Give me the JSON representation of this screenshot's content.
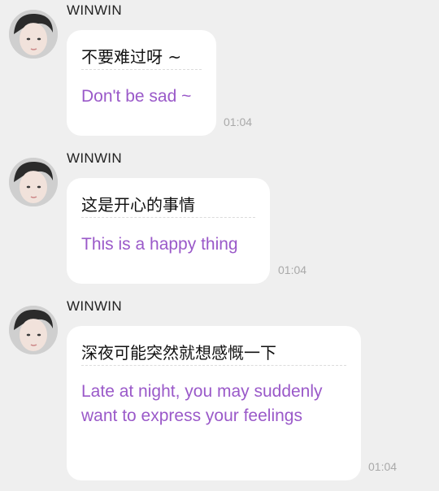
{
  "messages": [
    {
      "sender": "WINWIN",
      "original": "不要难过呀 ~",
      "translation": "Don't be sad ~",
      "time": "01:04"
    },
    {
      "sender": "WINWIN",
      "original": "这是开心的事情",
      "translation": "This is a happy thing",
      "time": "01:04"
    },
    {
      "sender": "WINWIN",
      "original": "深夜可能突然就想感慨一下",
      "translation": "Late at night, you may suddenly want to express your feelings",
      "time": "01:04"
    }
  ],
  "colors": {
    "background": "#efefef",
    "bubble": "#ffffff",
    "translation_text": "#9a59c9",
    "timestamp": "#a9a9a9"
  }
}
